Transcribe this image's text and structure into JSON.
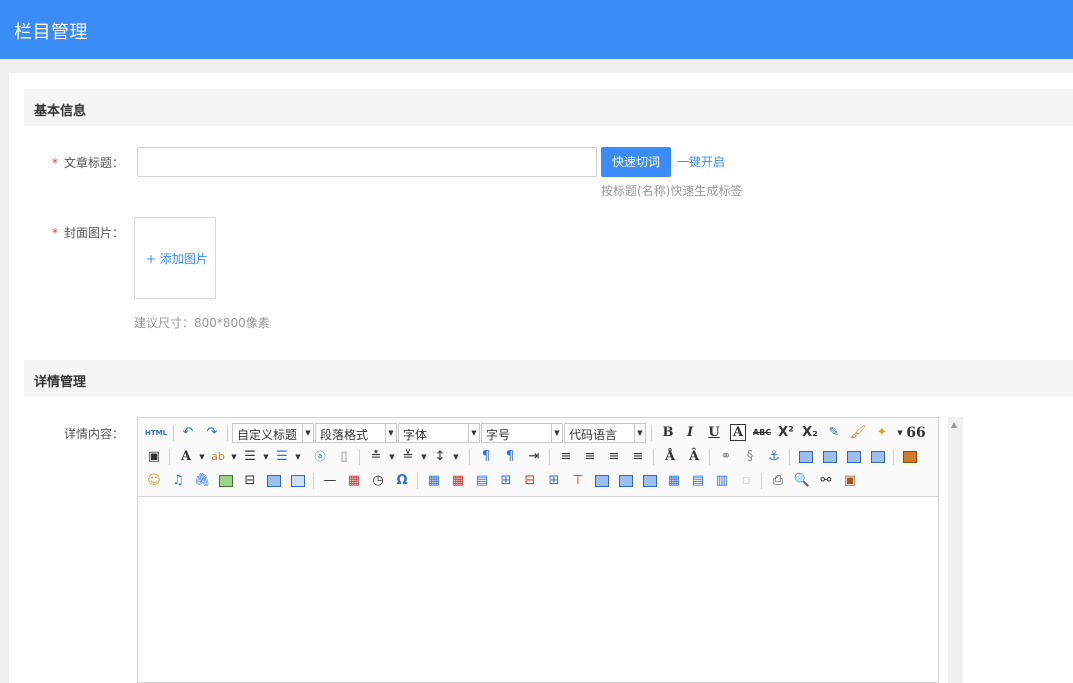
{
  "header": {
    "title": "栏目管理"
  },
  "basic": {
    "section_title": "基本信息",
    "title_label": "文章标题：",
    "title_value": "",
    "quick_button": "快速切词",
    "onekey_link": "一键开启",
    "title_hint": "按标题(名称)快速生成标签",
    "cover_label": "封面图片：",
    "add_image": "+ 添加图片",
    "cover_hint": "建议尺寸：800*800像素",
    "required_mark": "*"
  },
  "detail": {
    "section_title": "详情管理",
    "content_label": "详情内容："
  },
  "editor": {
    "html_label": "HTML",
    "combos": {
      "custom_title": "自定义标题",
      "paragraph": "段落格式",
      "font_family": "字体",
      "font_size": "字号",
      "code_lang": "代码语言"
    },
    "bold": "B",
    "italic": "I",
    "underline": "U",
    "strike": "ABC",
    "quote": "66"
  },
  "colors": {
    "accent": "#3b8cf7",
    "required": "#e4393c",
    "hint": "#999999"
  }
}
